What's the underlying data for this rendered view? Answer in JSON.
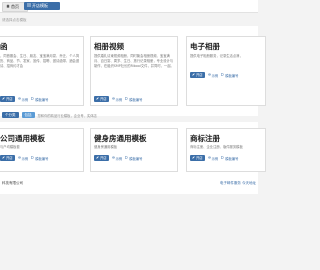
{
  "topbar": {
    "home_label": "首页",
    "template_label": "开店模板"
  },
  "subnote": "请选择点击模板",
  "section1_cards": [
    {
      "title": "函",
      "desc": "，同首服会、生日、朋友、宝宝满月宴、乔迁、个人简历、商品、节、发家、宣传、招聘、邀请函带、酒会邀请、招商约才会",
      "btn": "开店",
      "link1": "示例",
      "link2": "模板编号"
    },
    {
      "title": "相册视频",
      "desc": "提供婚礼请柬视频相册，同时聚会相册视频、宝宝满月、百日宴、周岁、生日、旅行记录相册，专业设计与制作，在组织SMP社长的Ribool文件，并同时，一起。",
      "btn": "开店",
      "link1": "示例",
      "link2": "模板编号"
    },
    {
      "title": "电子相册",
      "desc": "提供电子相册服务，记录生活点滴，",
      "btn": "开店",
      "link1": "示例",
      "link2": "模板编号"
    }
  ],
  "divider": {
    "pill_a": "个分类",
    "pill_b": "包括",
    "text": "您和你的精品行业模板，企业号、实体店"
  },
  "section2_cards": [
    {
      "title": "公司通用模板",
      "desc": "与户均模板套",
      "btn": "开店",
      "link1": "示例",
      "link2": "模板编号"
    },
    {
      "title": "健身房通用模板",
      "desc": "健身房通用模板",
      "btn": "开店",
      "link1": "示例",
      "link2": "模板编号"
    },
    {
      "title": "商标注册",
      "desc": "商标注册、企业注册、版件服务模板",
      "btn": "开店",
      "link1": "示例",
      "link2": "模板编号"
    }
  ],
  "footer": {
    "left": "科技有限公司",
    "right": "电子邮件服务 今天地址"
  }
}
